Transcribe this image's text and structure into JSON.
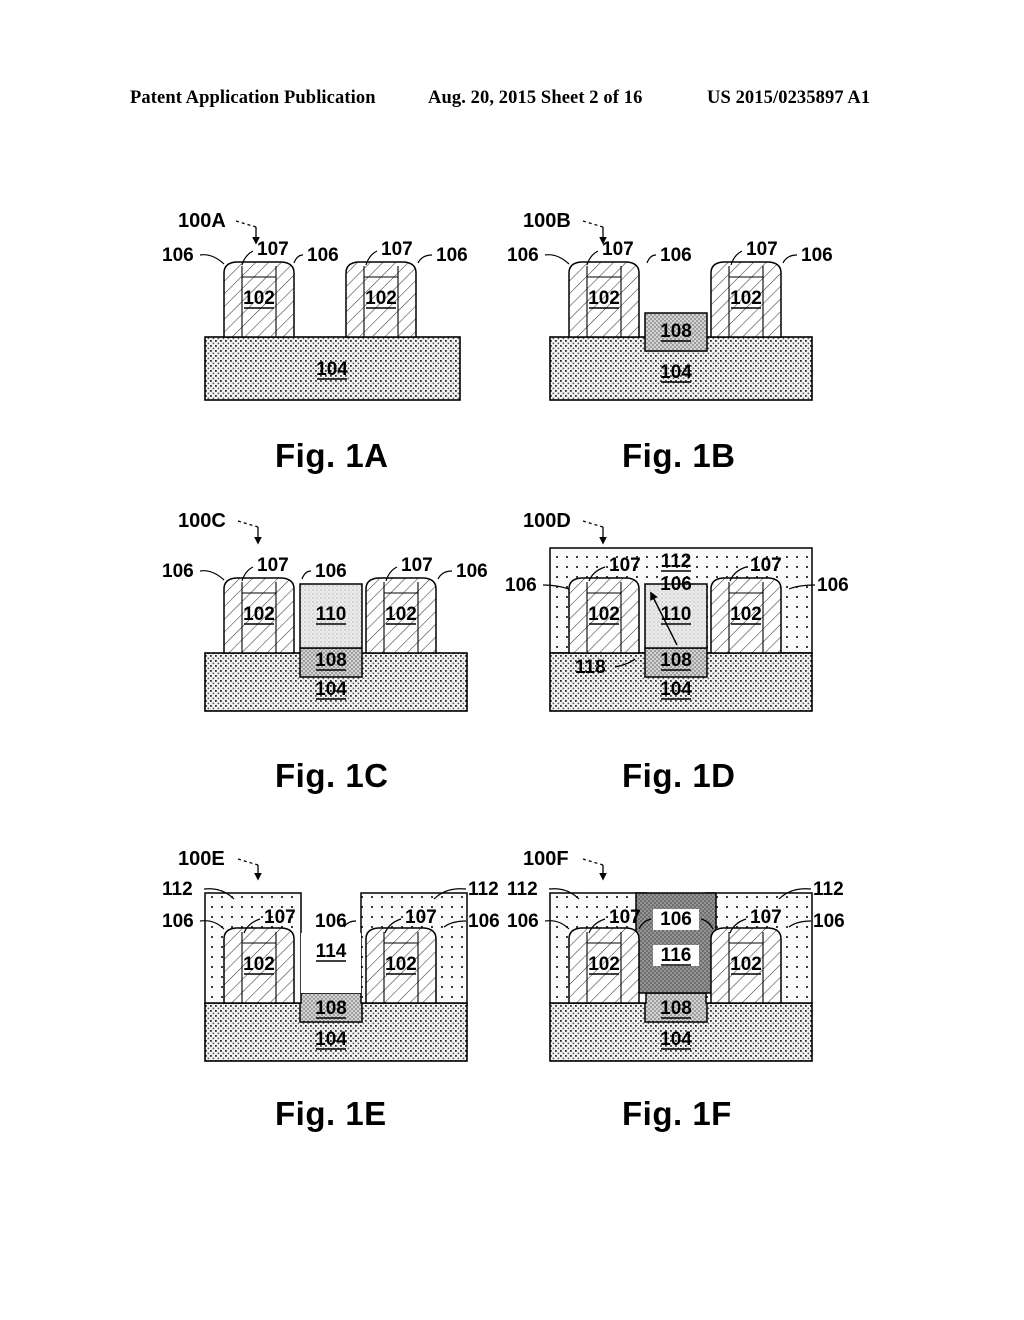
{
  "header": {
    "publication": "Patent Application Publication",
    "date_sheet": "Aug. 20, 2015  Sheet 2 of 16",
    "number": "US 2015/0235897 A1"
  },
  "figures": [
    {
      "id": "fig-1a",
      "caption": "Fig. 1A",
      "structure_id": "100A",
      "callouts_outer": [
        "106",
        "107",
        "106",
        "107",
        "106"
      ],
      "labels_inner": [
        "102",
        "102",
        "104"
      ],
      "elements": [
        {
          "ref": "102",
          "name": "fin",
          "pattern": "diagonal-hatch"
        },
        {
          "ref": "104",
          "name": "substrate",
          "pattern": "dense-dot-stipple"
        },
        {
          "ref": "106",
          "name": "spacer",
          "pattern": "diagonal-hatch"
        },
        {
          "ref": "107",
          "name": "fin-cap",
          "pattern": "diagonal-hatch"
        }
      ]
    },
    {
      "id": "fig-1b",
      "caption": "Fig. 1B",
      "structure_id": "100B",
      "callouts_outer": [
        "106",
        "107",
        "106",
        "107",
        "106"
      ],
      "labels_inner": [
        "102",
        "102",
        "108",
        "104"
      ],
      "elements": [
        {
          "ref": "102",
          "name": "fin",
          "pattern": "diagonal-hatch"
        },
        {
          "ref": "104",
          "name": "substrate",
          "pattern": "dense-dot-stipple"
        },
        {
          "ref": "106",
          "name": "spacer",
          "pattern": "diagonal-hatch"
        },
        {
          "ref": "107",
          "name": "fin-cap",
          "pattern": "diagonal-hatch"
        },
        {
          "ref": "108",
          "name": "trench-liner",
          "pattern": "fine-mesh-gray"
        }
      ]
    },
    {
      "id": "fig-1c",
      "caption": "Fig. 1C",
      "structure_id": "100C",
      "callouts_outer": [
        "106",
        "107",
        "106",
        "107",
        "106"
      ],
      "labels_inner": [
        "102",
        "110",
        "102",
        "108",
        "104"
      ],
      "elements": [
        {
          "ref": "102",
          "name": "fin",
          "pattern": "diagonal-hatch"
        },
        {
          "ref": "104",
          "name": "substrate",
          "pattern": "dense-dot-stipple"
        },
        {
          "ref": "106",
          "name": "spacer",
          "pattern": "diagonal-hatch"
        },
        {
          "ref": "107",
          "name": "fin-cap",
          "pattern": "diagonal-hatch"
        },
        {
          "ref": "108",
          "name": "trench-liner",
          "pattern": "fine-mesh-gray"
        },
        {
          "ref": "110",
          "name": "sacrificial-fill",
          "pattern": "light-stipple"
        }
      ]
    },
    {
      "id": "fig-1d",
      "caption": "Fig. 1D",
      "structure_id": "100D",
      "callouts_outer": [
        "106",
        "107",
        "107",
        "106",
        "118"
      ],
      "callouts_top": [
        "112",
        "106"
      ],
      "labels_inner": [
        "102",
        "110",
        "102",
        "108",
        "104"
      ],
      "elements": [
        {
          "ref": "102",
          "name": "fin",
          "pattern": "diagonal-hatch"
        },
        {
          "ref": "104",
          "name": "substrate",
          "pattern": "dense-dot-stipple"
        },
        {
          "ref": "106",
          "name": "spacer",
          "pattern": "diagonal-hatch"
        },
        {
          "ref": "107",
          "name": "fin-cap",
          "pattern": "diagonal-hatch"
        },
        {
          "ref": "108",
          "name": "trench-liner",
          "pattern": "fine-mesh-gray"
        },
        {
          "ref": "110",
          "name": "sacrificial-fill",
          "pattern": "light-stipple"
        },
        {
          "ref": "112",
          "name": "overlayer",
          "pattern": "sparse-dot-grid"
        },
        {
          "ref": "118",
          "name": "interface-callout",
          "pattern": "none"
        }
      ]
    },
    {
      "id": "fig-1e",
      "caption": "Fig. 1E",
      "structure_id": "100E",
      "callouts_outer": [
        "112",
        "106",
        "107",
        "106",
        "107",
        "106",
        "112"
      ],
      "labels_inner": [
        "102",
        "114",
        "102",
        "108",
        "104"
      ],
      "elements": [
        {
          "ref": "102",
          "name": "fin",
          "pattern": "diagonal-hatch"
        },
        {
          "ref": "104",
          "name": "substrate",
          "pattern": "dense-dot-stipple"
        },
        {
          "ref": "106",
          "name": "spacer",
          "pattern": "diagonal-hatch"
        },
        {
          "ref": "107",
          "name": "fin-cap",
          "pattern": "diagonal-hatch"
        },
        {
          "ref": "108",
          "name": "trench-liner",
          "pattern": "fine-mesh-gray"
        },
        {
          "ref": "112",
          "name": "overlayer-block",
          "pattern": "sparse-dot-grid"
        },
        {
          "ref": "114",
          "name": "open-trench",
          "pattern": "none"
        }
      ]
    },
    {
      "id": "fig-1f",
      "caption": "Fig. 1F",
      "structure_id": "100F",
      "callouts_outer": [
        "112",
        "106",
        "107",
        "106",
        "107",
        "106",
        "112"
      ],
      "callouts_top": [
        "106"
      ],
      "labels_inner": [
        "102",
        "116",
        "102",
        "108",
        "104"
      ],
      "elements": [
        {
          "ref": "102",
          "name": "fin",
          "pattern": "diagonal-hatch"
        },
        {
          "ref": "104",
          "name": "substrate",
          "pattern": "dense-dot-stipple"
        },
        {
          "ref": "106",
          "name": "spacer",
          "pattern": "diagonal-hatch"
        },
        {
          "ref": "107",
          "name": "fin-cap",
          "pattern": "diagonal-hatch"
        },
        {
          "ref": "108",
          "name": "trench-liner",
          "pattern": "fine-mesh-gray"
        },
        {
          "ref": "112",
          "name": "overlayer-block",
          "pattern": "sparse-dot-grid"
        },
        {
          "ref": "116",
          "name": "gate-fill",
          "pattern": "dark-mesh-gray"
        }
      ]
    }
  ],
  "colors": {
    "line": "#000000",
    "substrate_fill": "#f2f2f2",
    "liner_108": "#dcdcdc",
    "fill_110": "#ececec",
    "overlay_112": "#f4f4f4",
    "gate_116": "#9a9a9a",
    "page_bg": "#ffffff"
  }
}
